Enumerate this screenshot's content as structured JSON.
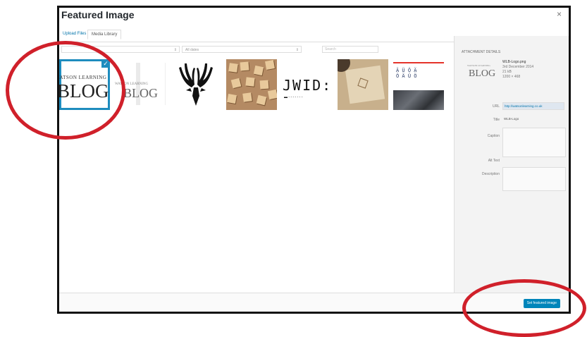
{
  "modal": {
    "title": "Featured Image",
    "close": "×"
  },
  "tabs": [
    {
      "label": "Upload Files"
    },
    {
      "label": "Media Library"
    }
  ],
  "filters": {
    "type_value": "",
    "date_value": "All dates",
    "search_placeholder": "Search"
  },
  "media": {
    "blog_small": "WATSON LEARNING",
    "blog_big": "BLOG",
    "blog2_small": "WATSON LEARNING",
    "blog2_big": "BLOG",
    "jw_text": "JWID:",
    "jw_dash": "▬ - - - - - - -",
    "grid_text": "Ä Ü Ö Ä\nÖ Ä Ü Ö"
  },
  "sidebar": {
    "heading": "Attachment Details",
    "thumb_small": "WATSON LEARNING",
    "thumb_big": "BLOG",
    "meta": {
      "filename": "WLB-Logo.png",
      "date": "3rd December 2014",
      "size": "21 kB",
      "dimensions": "1200 × 468"
    },
    "fields": {
      "url_label": "URL",
      "url_value": "http://watsonlearning.co.uk",
      "title_label": "Title",
      "title_value": "WLB-Logo",
      "caption_label": "Caption",
      "alt_label": "Alt Text",
      "description_label": "Description"
    }
  },
  "footer": {
    "set_button": "Set featured image"
  },
  "colors": {
    "annotation_ring": "#d0202a",
    "selection": "#1e8cbe",
    "primary_button": "#0085ba"
  }
}
